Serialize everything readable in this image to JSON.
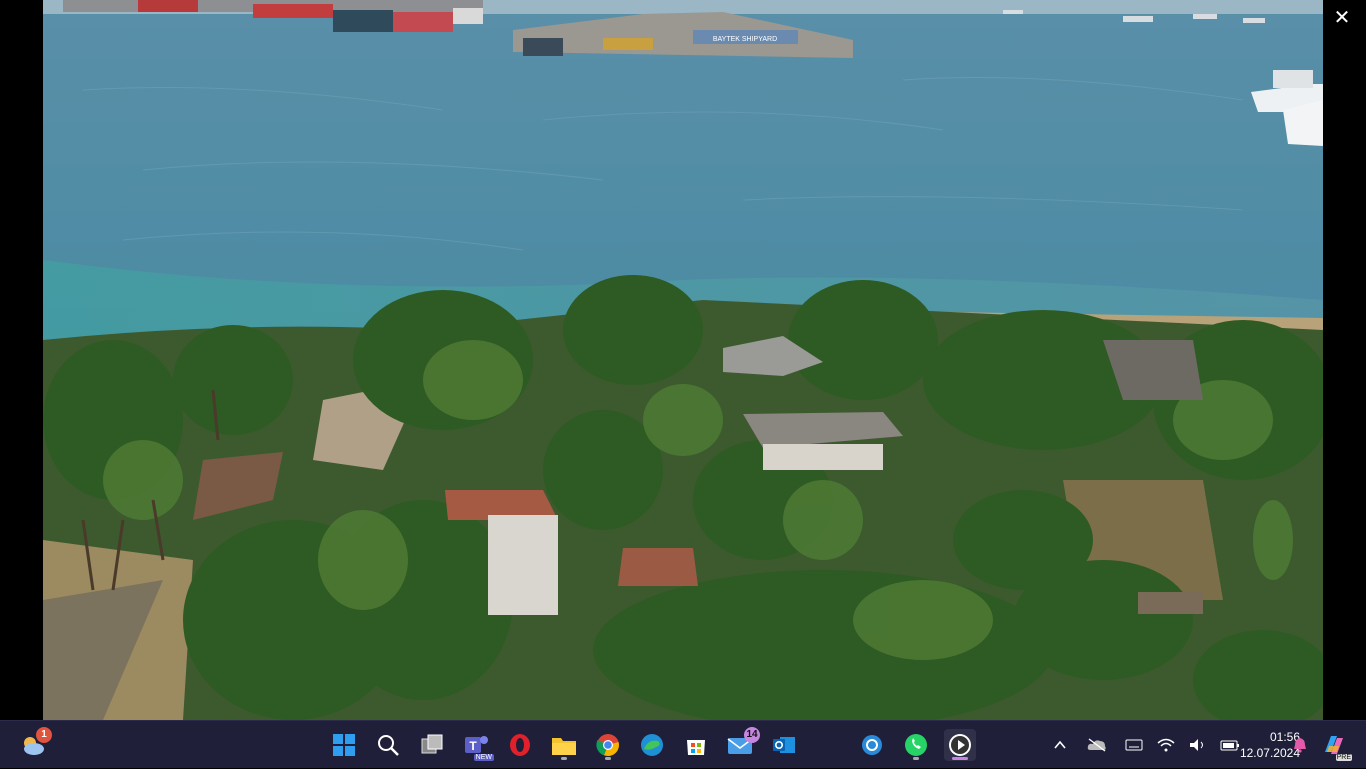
{
  "viewer": {
    "close_label": "✕"
  },
  "photo": {
    "sign_text": "BAYTEK SHIPYARD"
  },
  "taskbar": {
    "weather_badge": "1",
    "mail_badge": "14",
    "teams_tag": "NEW",
    "copilot_tag": "PRE",
    "time": "01:56",
    "date": "12.07.2024"
  }
}
